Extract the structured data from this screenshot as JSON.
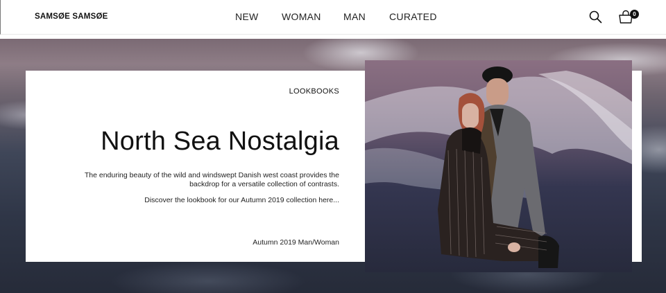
{
  "header": {
    "logo": "SAMSØE   SAMSØE",
    "nav": [
      {
        "label": "NEW"
      },
      {
        "label": "WOMAN"
      },
      {
        "label": "MAN"
      },
      {
        "label": "CURATED"
      }
    ],
    "bag_count": "0",
    "icons": [
      "search-icon",
      "shopping-bag-icon"
    ]
  },
  "hero": {
    "kicker": "LOOKBOOKS",
    "title": "North Sea Nostalgia",
    "description": "The enduring beauty of the wild and windswept Danish west coast provides the backdrop for a versatile collection of contrasts.",
    "cta": "Discover the lookbook for our Autumn 2019 collection here...",
    "meta": "Autumn 2019 Man/Woman"
  },
  "colors": {
    "text": "#111111",
    "card_bg": "#ffffff",
    "sea_dark": "#2f3647",
    "sea_mauve": "#7b6a74"
  }
}
